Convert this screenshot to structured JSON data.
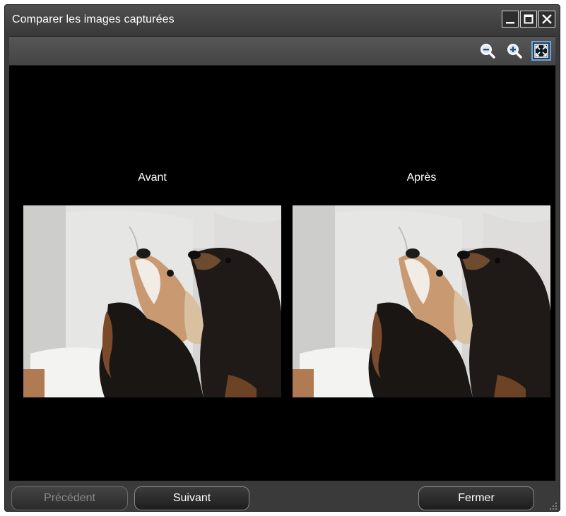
{
  "window": {
    "title": "Comparer les images capturées",
    "controls": [
      "minimize-icon",
      "maximize-icon",
      "close-icon"
    ]
  },
  "toolbar": {
    "tools": [
      {
        "name": "zoom-out-icon"
      },
      {
        "name": "zoom-in-icon"
      },
      {
        "name": "fit-to-window-icon",
        "active": true
      }
    ]
  },
  "viewer": {
    "before_label": "Avant",
    "after_label": "Après"
  },
  "footer": {
    "previous_label": "Précédent",
    "next_label": "Suivant",
    "close_label": "Fermer"
  },
  "colors": {
    "window_bg": "#3a3a3a",
    "viewer_bg": "#000000",
    "active_tool_border": "#6aa5e0",
    "disabled_text": "#8a8a8a"
  }
}
